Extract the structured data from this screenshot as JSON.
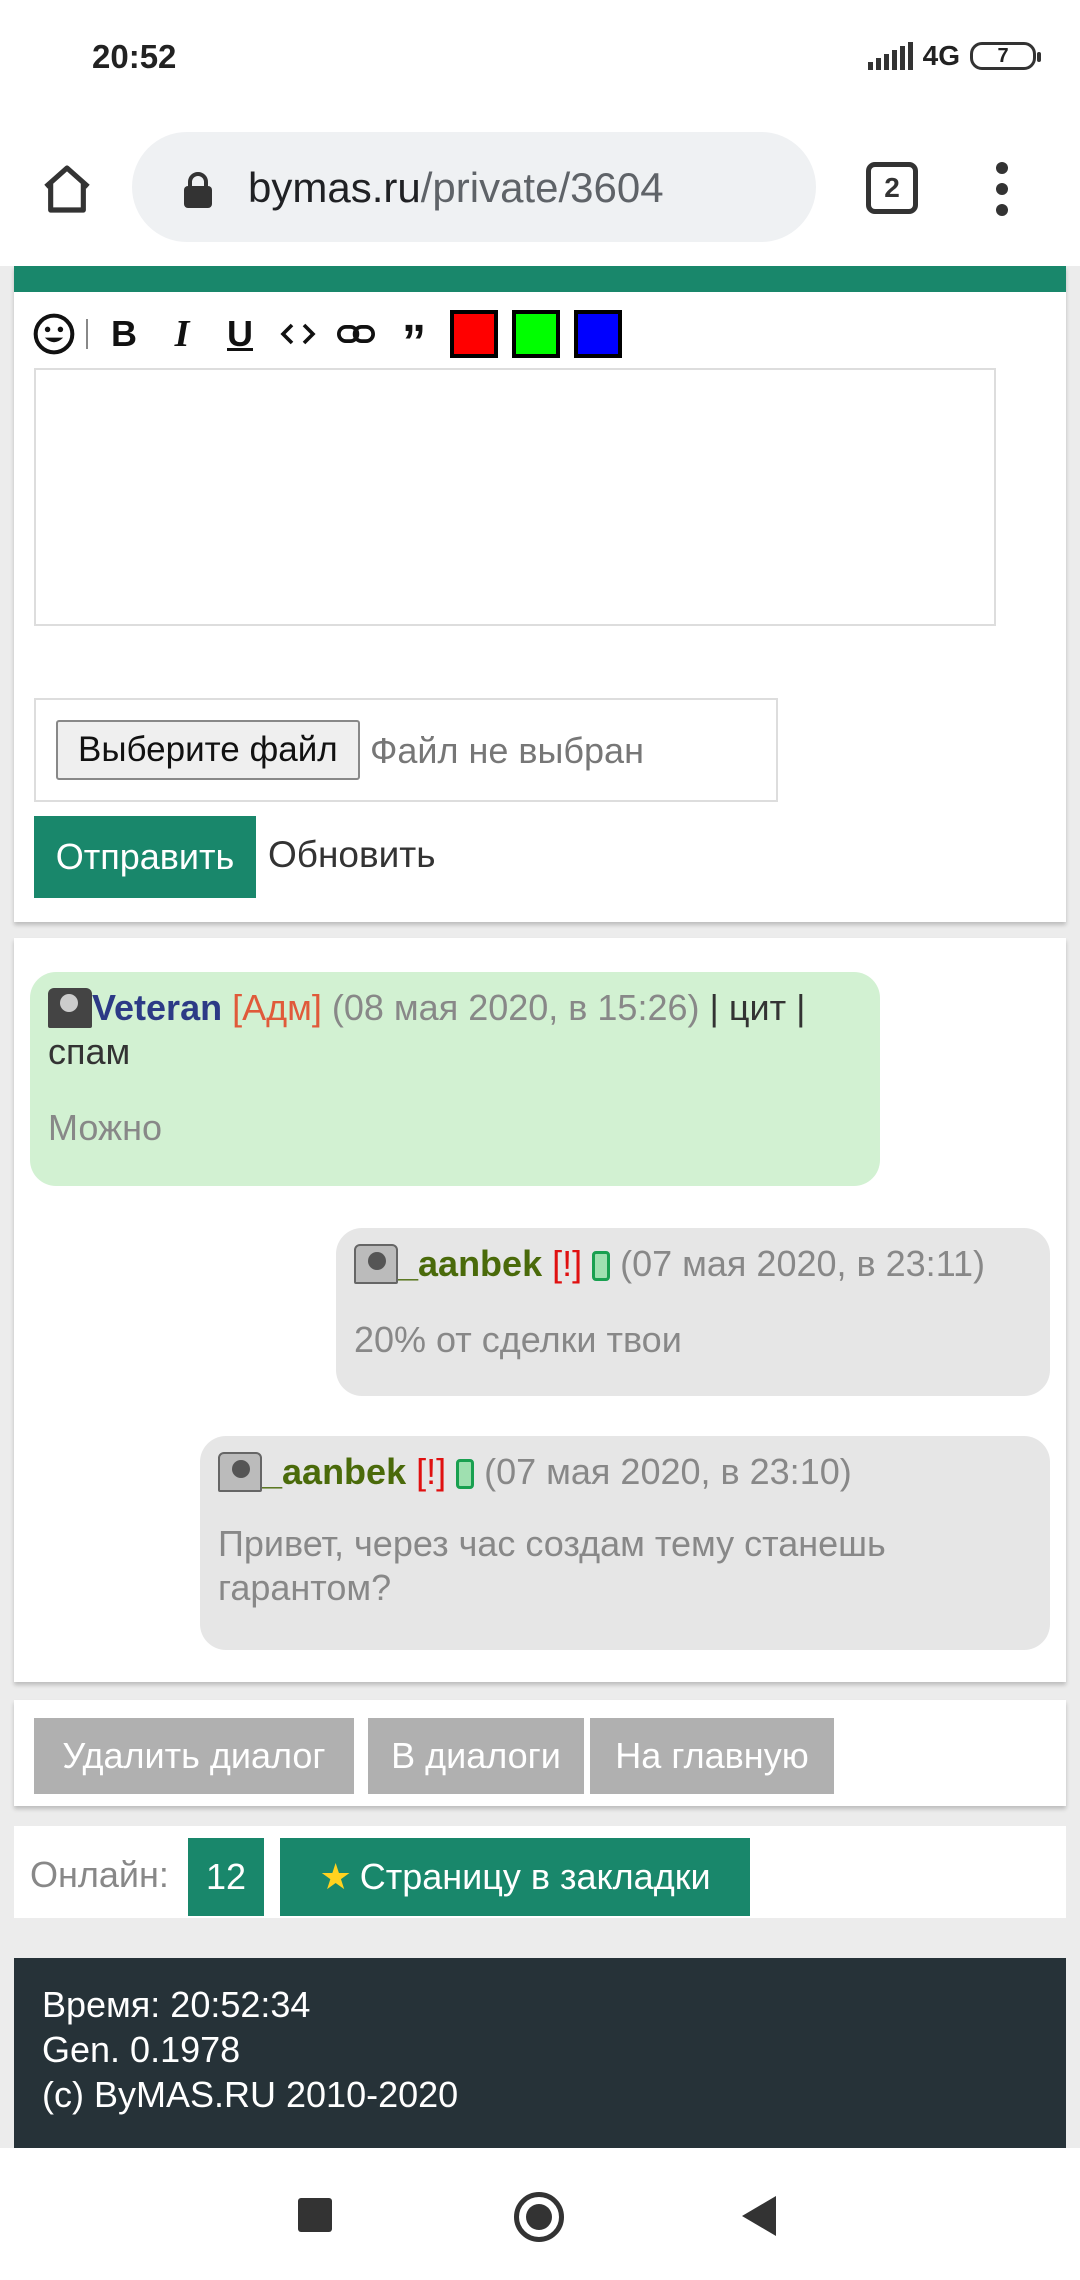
{
  "status_bar": {
    "time": "20:52",
    "network": "4G",
    "battery": "7"
  },
  "browser": {
    "url_domain": "bymas.ru",
    "url_path": "/private/3604",
    "tab_count": "2"
  },
  "editor": {
    "toolbar_icons": [
      "smiley-icon",
      "bold-icon",
      "italic-icon",
      "underline-icon",
      "code-icon",
      "link-icon",
      "quote-icon",
      "red-color",
      "green-color",
      "blue-color"
    ],
    "colors": {
      "red": "#ff0000",
      "green": "#00ff00",
      "blue": "#0000ff"
    },
    "file_button": "Выберите файл",
    "file_status": "Файл не выбран",
    "send_button": "Отправить",
    "refresh_button": "Обновить"
  },
  "messages": [
    {
      "author": "Veteran",
      "role": "[Адм]",
      "date": "(08 мая 2020, в 15:26)",
      "sep1": "|",
      "quote_link": "цит",
      "sep2": "|",
      "spam_link": "спам",
      "text": "Можно"
    },
    {
      "author": "_aanbek",
      "flag": "[!]",
      "date": "(07 мая 2020, в 23:11)",
      "text": "20% от сделки твои"
    },
    {
      "author": "_aanbek",
      "flag": "[!]",
      "date": "(07 мая 2020, в 23:10)",
      "text": "Привет, через час создам тему станешь гарантом?"
    }
  ],
  "actions": {
    "delete_dialog": "Удалить диалог",
    "to_dialogs": "В диалоги",
    "to_main": "На главную"
  },
  "online": {
    "label": "Онлайн:",
    "count": "12",
    "bookmark": "Страницу в закладки"
  },
  "footer": {
    "time": "Время: 20:52:34",
    "gen": "Gen. 0.1978",
    "copyright": "(c) ByMAS.RU 2010-2020"
  },
  "accent_color": "#19876b"
}
